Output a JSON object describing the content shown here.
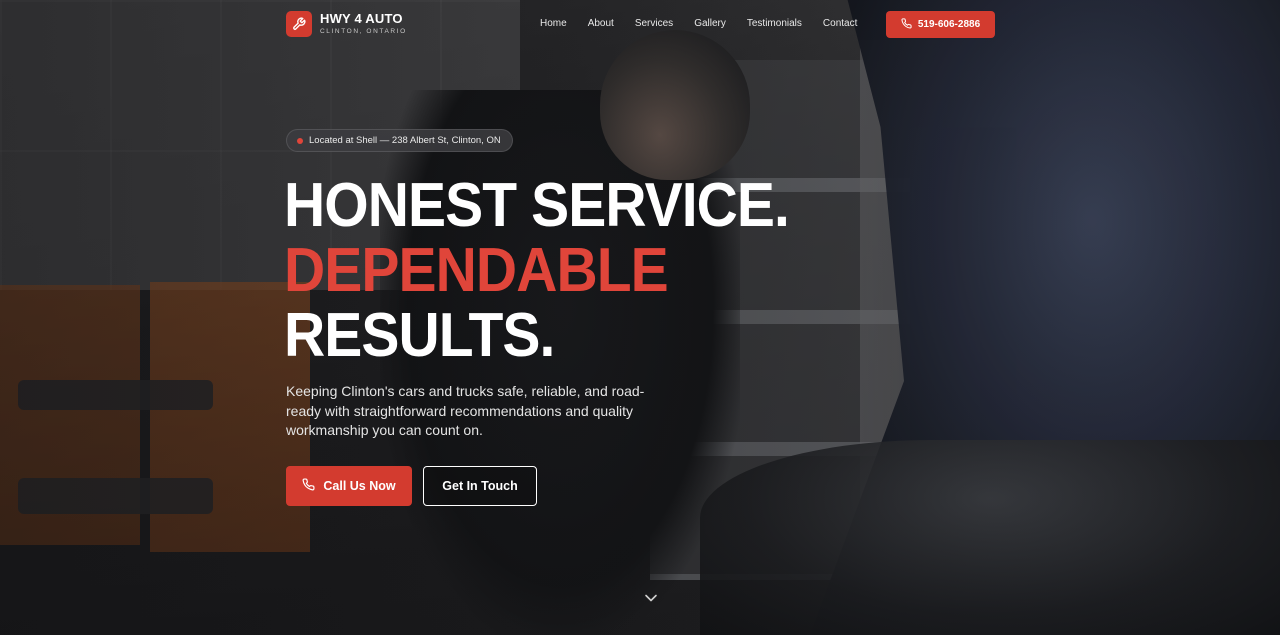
{
  "brand": {
    "name": "HWY 4 AUTO",
    "location": "CLINTON, ONTARIO",
    "logo_icon": "wrench-icon",
    "accent_color": "#d33b2f"
  },
  "nav": {
    "items": [
      "Home",
      "About",
      "Services",
      "Gallery",
      "Testimonials",
      "Contact"
    ],
    "phone_label": "519-606-2886",
    "phone_icon": "phone-icon"
  },
  "hero": {
    "location_pill": "Located at Shell — 238 Albert St, Clinton, ON",
    "headline_line1": "HONEST SERVICE.",
    "headline_line2": "DEPENDABLE",
    "headline_line3": "RESULTS.",
    "subtext": "Keeping Clinton's cars and trucks safe, reliable, and road-ready with straightforward recommendations and quality workmanship you can count on.",
    "primary_cta": "Call Us Now",
    "secondary_cta": "Get In Touch",
    "scroll_icon": "chevron-down-icon"
  }
}
